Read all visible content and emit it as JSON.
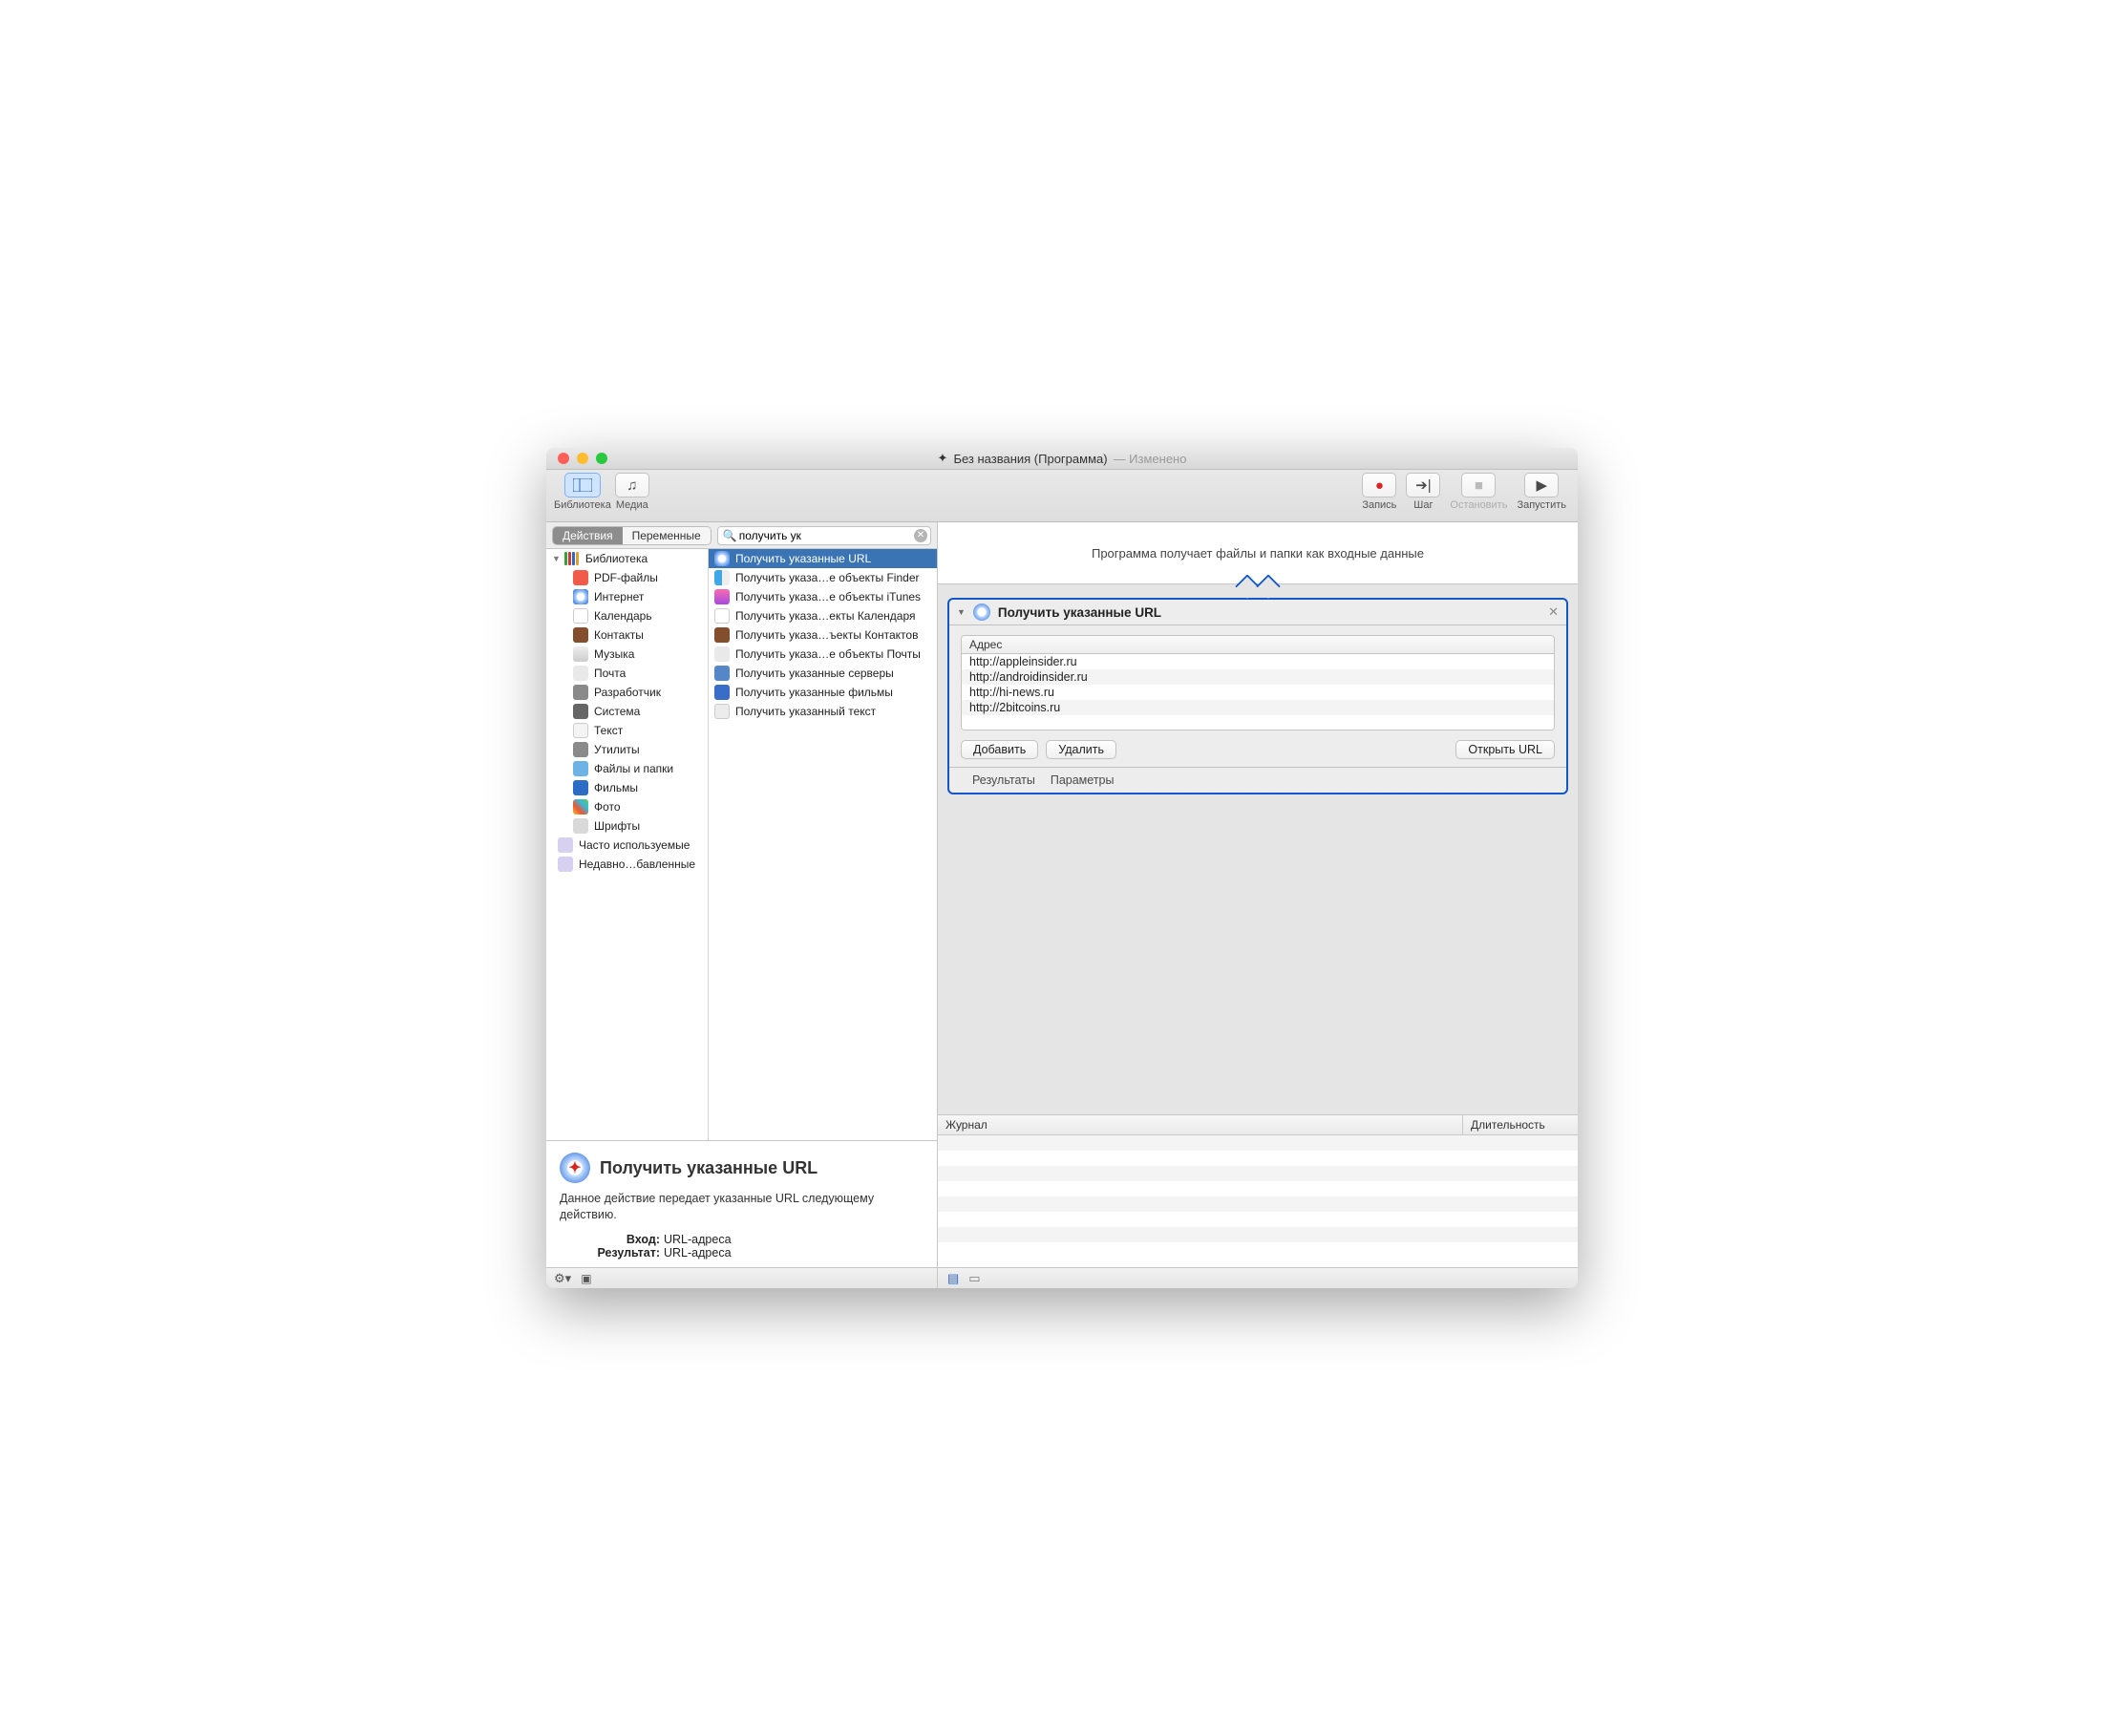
{
  "titlebar": {
    "doc_name": "Без названия (Программа)",
    "modified": "— Изменено"
  },
  "toolbar": {
    "library": "Библиотека",
    "media": "Медиа",
    "record": "Запись",
    "step": "Шаг",
    "stop": "Остановить",
    "run": "Запустить"
  },
  "library": {
    "tab_actions": "Действия",
    "tab_variables": "Переменные",
    "search_value": "получить ук",
    "root": "Библиотека",
    "categories": [
      {
        "icon": "pdf",
        "label": "PDF-файлы"
      },
      {
        "icon": "safari",
        "label": "Интернет"
      },
      {
        "icon": "cal",
        "label": "Календарь"
      },
      {
        "icon": "contacts",
        "label": "Контакты"
      },
      {
        "icon": "music",
        "label": "Музыка"
      },
      {
        "icon": "mail",
        "label": "Почта"
      },
      {
        "icon": "dev",
        "label": "Разработчик"
      },
      {
        "icon": "sys",
        "label": "Система"
      },
      {
        "icon": "text",
        "label": "Текст"
      },
      {
        "icon": "util",
        "label": "Утилиты"
      },
      {
        "icon": "folder",
        "label": "Файлы и папки"
      },
      {
        "icon": "globe",
        "label": "Фильмы"
      },
      {
        "icon": "photo",
        "label": "Фото"
      },
      {
        "icon": "font",
        "label": "Шрифты"
      }
    ],
    "groups": [
      {
        "icon": "purple",
        "label": "Часто используемые"
      },
      {
        "icon": "purple",
        "label": "Недавно…бавленные"
      }
    ],
    "actions": [
      {
        "icon": "safari",
        "label": "Получить указанные URL",
        "selected": true
      },
      {
        "icon": "finder",
        "label": "Получить указа…е объекты Finder"
      },
      {
        "icon": "itunes",
        "label": "Получить указа…е объекты iTunes"
      },
      {
        "icon": "cal",
        "label": "Получить указа…екты Календаря"
      },
      {
        "icon": "contacts",
        "label": "Получить указа…ъекты Контактов"
      },
      {
        "icon": "mail",
        "label": "Получить указа…е объекты Почты"
      },
      {
        "icon": "server",
        "label": "Получить указанные серверы"
      },
      {
        "icon": "film",
        "label": "Получить указанные фильмы"
      },
      {
        "icon": "trash",
        "label": "Получить указанный текст"
      }
    ]
  },
  "info": {
    "title": "Получить указанные URL",
    "desc": "Данное действие передает указанные URL следующему действию.",
    "input_label": "Вход:",
    "input_value": "URL-адреса",
    "result_label": "Результат:",
    "result_value": "URL-адреса"
  },
  "workflow": {
    "dropzone": "Программа получает файлы и папки как входные данные",
    "action_title": "Получить указанные URL",
    "address_col": "Адрес",
    "urls": [
      "http://appleinsider.ru",
      "http://androidinsider.ru",
      "http://hi-news.ru",
      "http://2bitcoins.ru"
    ],
    "add": "Добавить",
    "remove": "Удалить",
    "open": "Открыть URL",
    "results": "Результаты",
    "options": "Параметры"
  },
  "log": {
    "col_journal": "Журнал",
    "col_duration": "Длительность"
  }
}
